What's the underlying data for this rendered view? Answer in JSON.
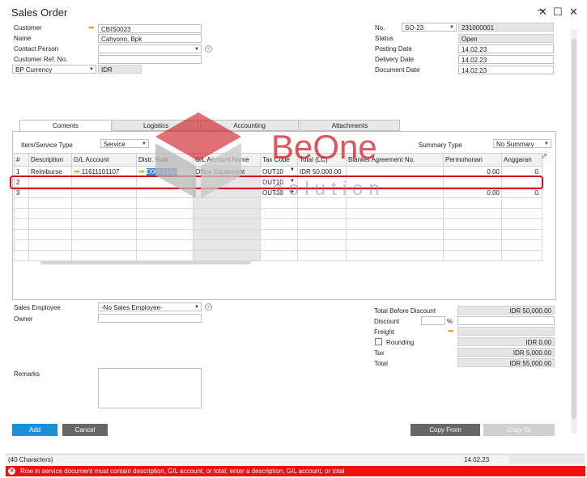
{
  "window": {
    "title": "Sales Order"
  },
  "header_left": {
    "customer_label": "Customer",
    "customer_value": "CBIS0023",
    "name_label": "Name",
    "name_value": "Cahyono, Bpk",
    "contact_label": "Contact Person",
    "contact_value": "",
    "ref_label": "Customer Ref. No.",
    "ref_value": "",
    "currency_type": "BP Currency",
    "currency_value": "IDR"
  },
  "header_right": {
    "no_label": "No.",
    "series": "SO-23",
    "number": "231000001",
    "status_label": "Status",
    "status_value": "Open",
    "posting_label": "Posting Date",
    "posting_value": "14.02.23",
    "delivery_label": "Delivery Date",
    "delivery_value": "14.02.23",
    "document_label": "Document Date",
    "document_value": "14.02.23"
  },
  "tabs": [
    {
      "label": "Contents"
    },
    {
      "label": "Logistics"
    },
    {
      "label": "Accounting"
    },
    {
      "label": "Attachments"
    }
  ],
  "contents": {
    "item_type_label": "Item/Service Type",
    "item_type_value": "Service",
    "summary_label": "Summary Type",
    "summary_value": "No Summary"
  },
  "grid": {
    "columns": [
      "#",
      "Description",
      "G/L Account",
      "Distr. Rule",
      "G/L Account Name",
      "Tax Code",
      "Total (LC)",
      "Blanket Agreement No.",
      "Permohonan",
      "Anggaran"
    ],
    "rows": [
      {
        "num": "1",
        "desc": "Reimburse",
        "gl": "11611101107",
        "distr": "D001#1A0",
        "glname": "Office Equipment",
        "tax": "OUT10",
        "total": "IDR 50,000.00",
        "blanket": "",
        "perm": "0.00",
        "ang": "0."
      },
      {
        "num": "2",
        "desc": "",
        "gl": "",
        "distr": "",
        "glname": "",
        "tax": "OUT10",
        "total": "",
        "blanket": "",
        "perm": "",
        "ang": ""
      },
      {
        "num": "3",
        "desc": "",
        "gl": "",
        "distr": "",
        "glname": "",
        "tax": "OUT10",
        "total": "",
        "blanket": "",
        "perm": "0.00",
        "ang": "0."
      }
    ]
  },
  "watermark": {
    "brand": "BeOne",
    "sub": "solution"
  },
  "footer_left": {
    "sales_employee_label": "Sales Employee",
    "sales_employee_value": "-No Sales Employee-",
    "owner_label": "Owner",
    "owner_value": "",
    "remarks_label": "Remarks",
    "remarks_value": ""
  },
  "totals": {
    "before_discount_label": "Total Before Discount",
    "before_discount_value": "IDR 50,000.00",
    "discount_label": "Discount",
    "discount_pct": "",
    "pct_sign": "%",
    "discount_value": "",
    "freight_label": "Freight",
    "freight_value": "",
    "rounding_label": "Rounding",
    "rounding_value": "IDR 0.00",
    "tax_label": "Tax",
    "tax_value": "IDR 5,000.00",
    "total_label": "Total",
    "total_value": "IDR 55,000.00"
  },
  "buttons": {
    "add": "Add",
    "cancel": "Cancel",
    "copy_from": "Copy From",
    "copy_to": "Copy To"
  },
  "status_bar": {
    "chars": "(40 Characters)",
    "date": "14.02.23"
  },
  "error": {
    "message": "Row in service document must contain description, G/L account, or total; enter a description, G/L account, or total"
  },
  "colors": {
    "add_button": "#1a8fd8",
    "cancel_button": "#666666",
    "copy_from_button": "#666666",
    "copy_to_button": "#d0d0d0",
    "error_bar": "#ee1111",
    "highlight": "#d01020",
    "watermark_red": "#d02028"
  }
}
